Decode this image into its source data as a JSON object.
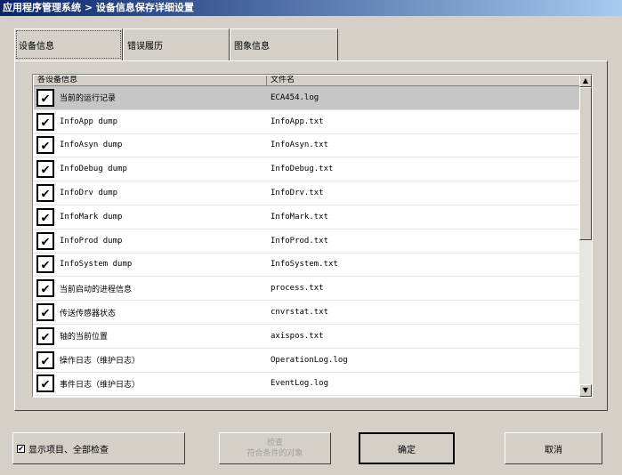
{
  "window": {
    "title": "应用程序管理系统 > 设备信息保存详细设置"
  },
  "tabs": [
    {
      "label": "设备信息"
    },
    {
      "label": "错误履历"
    },
    {
      "label": "图象信息"
    }
  ],
  "list": {
    "columns": [
      "各设备信息",
      "文件名"
    ],
    "rows": [
      {
        "name": "当前的运行记录",
        "file": "ECA454.log",
        "checked": true,
        "selected": true
      },
      {
        "name": "InfoApp dump",
        "file": "InfoApp.txt",
        "checked": true
      },
      {
        "name": "InfoAsyn dump",
        "file": "InfoAsyn.txt",
        "checked": true
      },
      {
        "name": "InfoDebug dump",
        "file": "InfoDebug.txt",
        "checked": true
      },
      {
        "name": "InfoDrv dump",
        "file": "InfoDrv.txt",
        "checked": true
      },
      {
        "name": "InfoMark dump",
        "file": "InfoMark.txt",
        "checked": true
      },
      {
        "name": "InfoProd dump",
        "file": "InfoProd.txt",
        "checked": true
      },
      {
        "name": "InfoSystem dump",
        "file": "InfoSystem.txt",
        "checked": true
      },
      {
        "name": "当前启动的进程信息",
        "file": "process.txt",
        "checked": true
      },
      {
        "name": "传送传感器状态",
        "file": "cnvrstat.txt",
        "checked": true
      },
      {
        "name": "轴的当前位置",
        "file": "axispos.txt",
        "checked": true
      },
      {
        "name": "操作日志（维护日志）",
        "file": "OperationLog.log",
        "checked": true
      },
      {
        "name": "事件日志（维护日志）",
        "file": "EventLog.log",
        "checked": true
      }
    ]
  },
  "footer": {
    "show_all_label": "显示项目、全部检查",
    "show_all_checked": true,
    "check_btn_line1": "检查",
    "check_btn_line2": "符合条件的对象",
    "ok_label": "确定",
    "cancel_label": "取消"
  },
  "icons": {
    "check": "checkmark-icon",
    "scroll_up": "arrow-up-icon",
    "scroll_down": "arrow-down-icon"
  }
}
